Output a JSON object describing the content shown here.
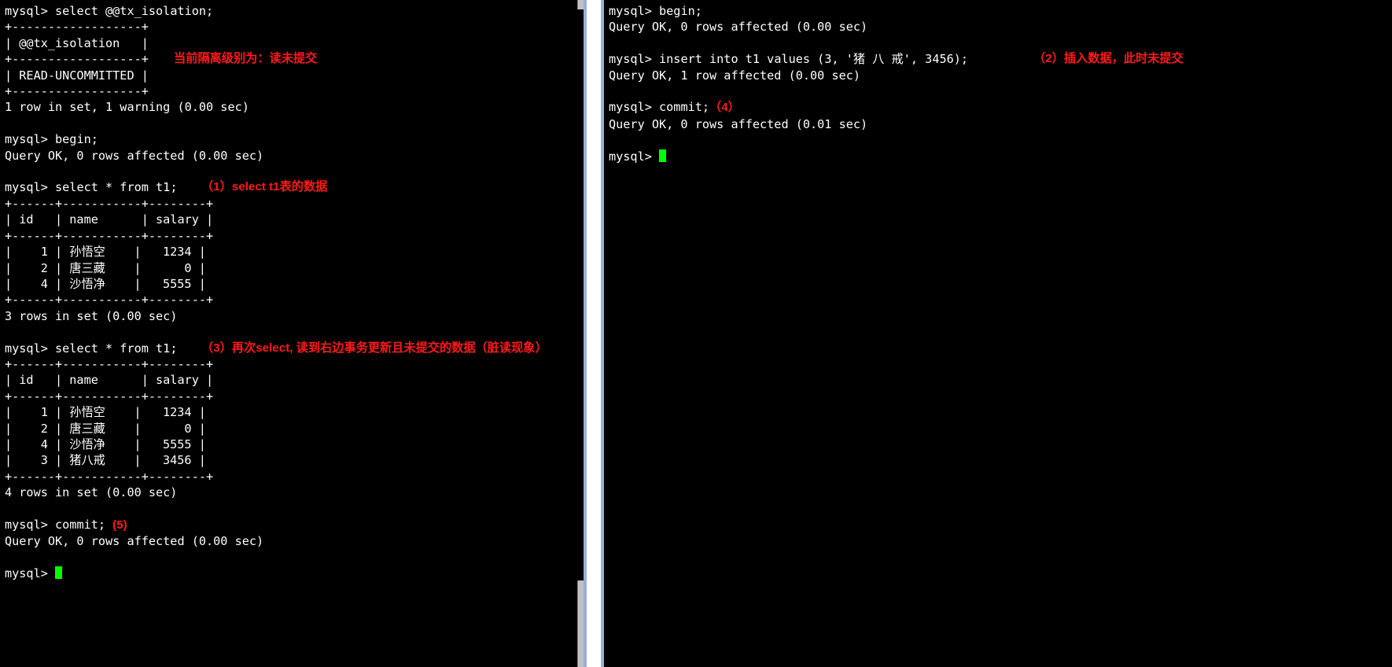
{
  "left": {
    "l1_prompt": "mysql> ",
    "l1_cmd": "select @@tx_isolation;",
    "border1": "+------------------+",
    "hdr_iso": "| @@tx_isolation   |",
    "iso_val": "| READ-UNCOMMITTED |",
    "annot_iso": "当前隔离级别为：读未提交",
    "rows_iso": "1 row in set, 1 warning (0.00 sec)",
    "blank": " ",
    "l2_prompt": "mysql> ",
    "l2_cmd": "begin;",
    "begin_ok": "Query OK, 0 rows affected (0.00 sec)",
    "l3_prompt": "mysql> ",
    "l3_cmd": "select * from t1;",
    "annot_sel1": "（1）select t1表的数据",
    "tbl_border": "+------+-----------+--------+",
    "tbl_hdr": "| id   | name      | salary |",
    "r1_1": "|    1 | 孙悟空    |   1234 |",
    "r1_2": "|    2 | 唐三藏    |      0 |",
    "r1_3": "|    4 | 沙悟净    |   5555 |",
    "rows_sel1": "3 rows in set (0.00 sec)",
    "l4_prompt": "mysql> ",
    "l4_cmd": "select * from t1;",
    "annot_sel2": "（3）再次select, 读到右边事务更新且未提交的数据（脏读现象）",
    "r2_1": "|    1 | 孙悟空    |   1234 |",
    "r2_2": "|    2 | 唐三藏    |      0 |",
    "r2_3": "|    4 | 沙悟净    |   5555 |",
    "r2_4": "|    3 | 猪八戒    |   3456 |",
    "rows_sel2": "4 rows in set (0.00 sec)",
    "l5_prompt": "mysql> ",
    "l5_cmd": "commit; ",
    "annot_commit": "(5)",
    "commit_ok": "Query OK, 0 rows affected (0.00 sec)",
    "l6_prompt": "mysql> "
  },
  "right": {
    "r1_prompt": "mysql> ",
    "r1_cmd": "begin;",
    "begin_ok": "Query OK, 0 rows affected (0.00 sec)",
    "blank": " ",
    "r2_prompt": "mysql> ",
    "r2_cmd": "insert into t1 values (3, '猪 八 戒', 3456);",
    "annot_ins": "（2）插入数据，此时未提交",
    "ins_ok": "Query OK, 1 row affected (0.00 sec)",
    "r3_prompt": "mysql> ",
    "r3_cmd": "commit;",
    "annot_commit2": "（4）",
    "commit_ok2": "Query OK, 0 rows affected (0.01 sec)",
    "r4_prompt": "mysql> "
  },
  "chart_data": {
    "type": "table",
    "isolation_level": "READ-UNCOMMITTED",
    "columns": [
      "id",
      "name",
      "salary"
    ],
    "select_1_rows": [
      {
        "id": 1,
        "name": "孙悟空",
        "salary": 1234
      },
      {
        "id": 2,
        "name": "唐三藏",
        "salary": 0
      },
      {
        "id": 4,
        "name": "沙悟净",
        "salary": 5555
      }
    ],
    "select_2_rows": [
      {
        "id": 1,
        "name": "孙悟空",
        "salary": 1234
      },
      {
        "id": 2,
        "name": "唐三藏",
        "salary": 0
      },
      {
        "id": 4,
        "name": "沙悟净",
        "salary": 5555
      },
      {
        "id": 3,
        "name": "猪八戒",
        "salary": 3456
      }
    ],
    "insert_statement": {
      "id": 3,
      "name": "猪八戒",
      "salary": 3456
    },
    "annotations": {
      "1": "select t1表的数据",
      "2": "插入数据，此时未提交",
      "3": "再次select, 读到右边事务更新且未提交的数据（脏读现象）",
      "4": "commit",
      "5": "commit",
      "isolation": "当前隔离级别为：读未提交"
    }
  }
}
